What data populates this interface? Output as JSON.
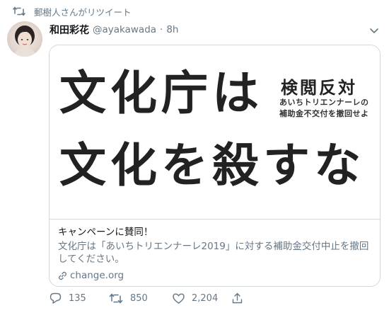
{
  "retweet_context": {
    "text": "郵樹人さんがリツイート",
    "icon": "retweet-icon"
  },
  "tweet": {
    "display_name": "和田彩花",
    "handle": "@ayakawada",
    "separator": "·",
    "time": "8h"
  },
  "card": {
    "image": {
      "headline_line1": "文化庁は",
      "headline_line2": "文化を殺すな",
      "side_title": "検閲反対",
      "side_line1": "あいちトリエンナーレの",
      "side_line2": "補助金不交付を撤回せよ"
    },
    "title": "キャンペーンに賛同！",
    "description": "文化庁は「あいちトリエンナーレ2019」に対する補助金交付中止を撤回してください。",
    "domain": "change.org"
  },
  "actions": {
    "reply_count": "135",
    "retweet_count": "850",
    "like_count": "2,204"
  },
  "colors": {
    "secondary_text": "#657786",
    "border": "#cfd9de",
    "primary_text": "#14171a"
  }
}
